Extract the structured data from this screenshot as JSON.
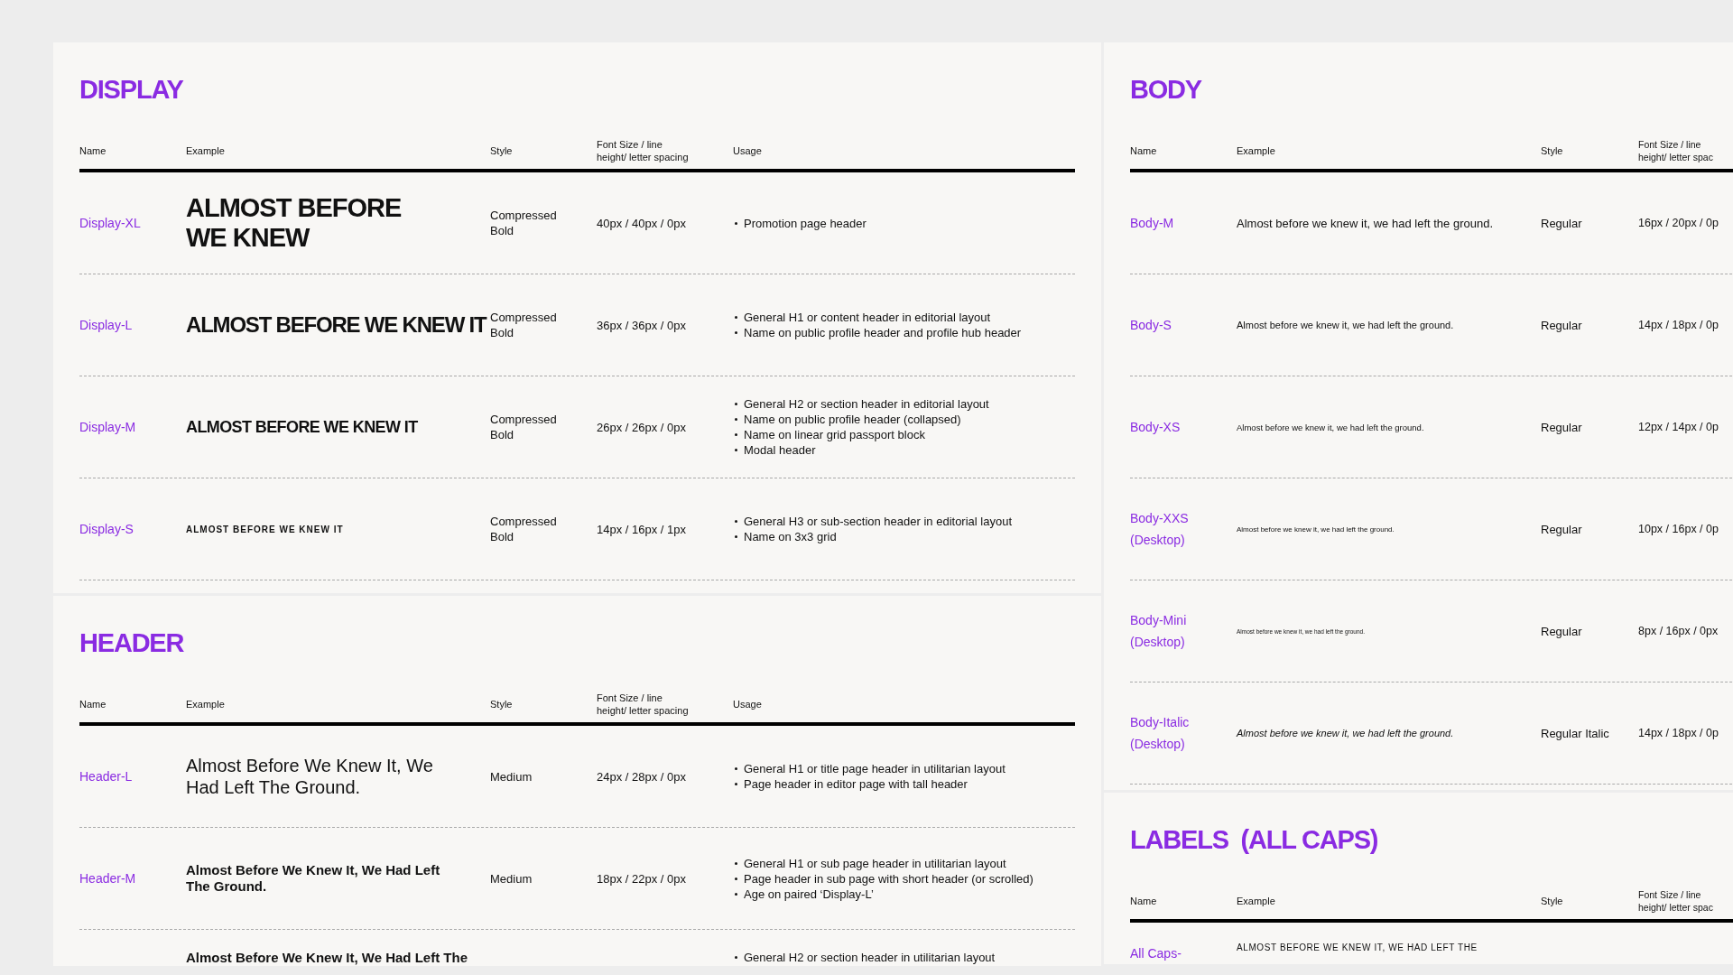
{
  "panels": [
    {
      "sections": [
        {
          "title": "DISPLAY",
          "columns": [
            "Name",
            "Example",
            "Style",
            "Font Size / line\nheight/ letter spacing",
            "Usage"
          ],
          "rows": [
            {
              "kind": "display-xl",
              "name": "Display-XL",
              "example": "ALMOST BEFORE WE KNEW",
              "style": "Compressed Bold",
              "size": "40px / 40px / 0px",
              "usage": [
                "Promotion page header"
              ]
            },
            {
              "kind": "display-l",
              "name": "Display-L",
              "example": "ALMOST BEFORE WE KNEW IT",
              "style": "Compressed Bold",
              "size": "36px / 36px / 0px",
              "usage": [
                "General H1 or content header in editorial layout",
                "Name on public profile header and profile hub header"
              ]
            },
            {
              "kind": "display-m",
              "name": "Display-M",
              "example": "ALMOST BEFORE WE KNEW IT",
              "style": "Compressed Bold",
              "size": "26px / 26px / 0px",
              "usage": [
                "General H2 or section header in editorial layout",
                "Name on public profile header (collapsed)",
                "Name on linear grid passport block",
                "Modal header"
              ]
            },
            {
              "kind": "display-s",
              "name": "Display-S",
              "example": "ALMOST BEFORE WE KNEW IT",
              "style": "Compressed Bold",
              "size": "14px / 16px / 1px",
              "usage": [
                "General H3 or sub-section header in editorial layout",
                "Name on 3x3 grid"
              ]
            }
          ]
        },
        {
          "title": "HEADER",
          "columns": [
            "Name",
            "Example",
            "Style",
            "Font Size / line\nheight/ letter spacing",
            "Usage"
          ],
          "rows": [
            {
              "kind": "header-l",
              "name": "Header-L",
              "example": "Almost Before We Knew It, We Had Left The Ground.",
              "style": "Medium",
              "size": "24px / 28px / 0px",
              "usage": [
                "General H1 or title page header in utilitarian layout",
                "Page header in editor page with tall header"
              ]
            },
            {
              "kind": "header-m",
              "name": "Header-M",
              "example": "Almost Before We Knew It, We Had Left The Ground.",
              "style": "Medium",
              "size": "18px / 22px / 0px",
              "usage": [
                "General H1 or sub page header in utilitarian layout",
                "Page header in sub page with short header (or scrolled)",
                "Age on paired ‘Display-L’"
              ]
            },
            {
              "kind": "partial-header",
              "example": "Almost Before We Knew It, We Had Left The",
              "usage": [
                "General H2 or section header in utilitarian layout"
              ]
            }
          ]
        }
      ]
    },
    {
      "sections": [
        {
          "title": "BODY",
          "columns": [
            "Name",
            "Example",
            "Style",
            "Font Size / line\nheight/ letter spac"
          ],
          "rows": [
            {
              "kind": "body-m",
              "name": "Body-M",
              "example": "Almost before we knew it, we had left the ground.",
              "style": "Regular",
              "size": "16px / 20px / 0p"
            },
            {
              "kind": "body-s",
              "name": "Body-S",
              "example": "Almost before we knew it, we had left the ground.",
              "style": "Regular",
              "size": "14px / 18px / 0p"
            },
            {
              "kind": "body-xs",
              "name": "Body-XS",
              "example": "Almost before we knew it, we had left the ground.",
              "style": "Regular",
              "size": "12px / 14px / 0p"
            },
            {
              "kind": "body-xxs",
              "name": "Body-XXS (Desktop)",
              "example": "Almost before we knew it, we had left the ground.",
              "style": "Regular",
              "size": "10px / 16px / 0p"
            },
            {
              "kind": "body-mini",
              "name": "Body-Mini (Desktop)",
              "example": "Almost before we knew it, we had left the ground.",
              "style": "Regular",
              "size": "8px / 16px / 0px"
            },
            {
              "kind": "body-italic",
              "name": "Body-Italic (Desktop)",
              "example": "Almost before we knew it, we had left the ground.",
              "style": "Regular Italic",
              "size": "14px / 18px / 0p"
            }
          ]
        },
        {
          "title": "LABELS  (ALL CAPS)",
          "columns": [
            "Name",
            "Example",
            "Style",
            "Font Size / line\nheight/ letter spac"
          ],
          "rows": [
            {
              "kind": "partial-caps",
              "name": "All Caps-",
              "example": "ALMOST BEFORE WE KNEW IT, WE HAD LEFT THE"
            }
          ]
        }
      ]
    }
  ]
}
